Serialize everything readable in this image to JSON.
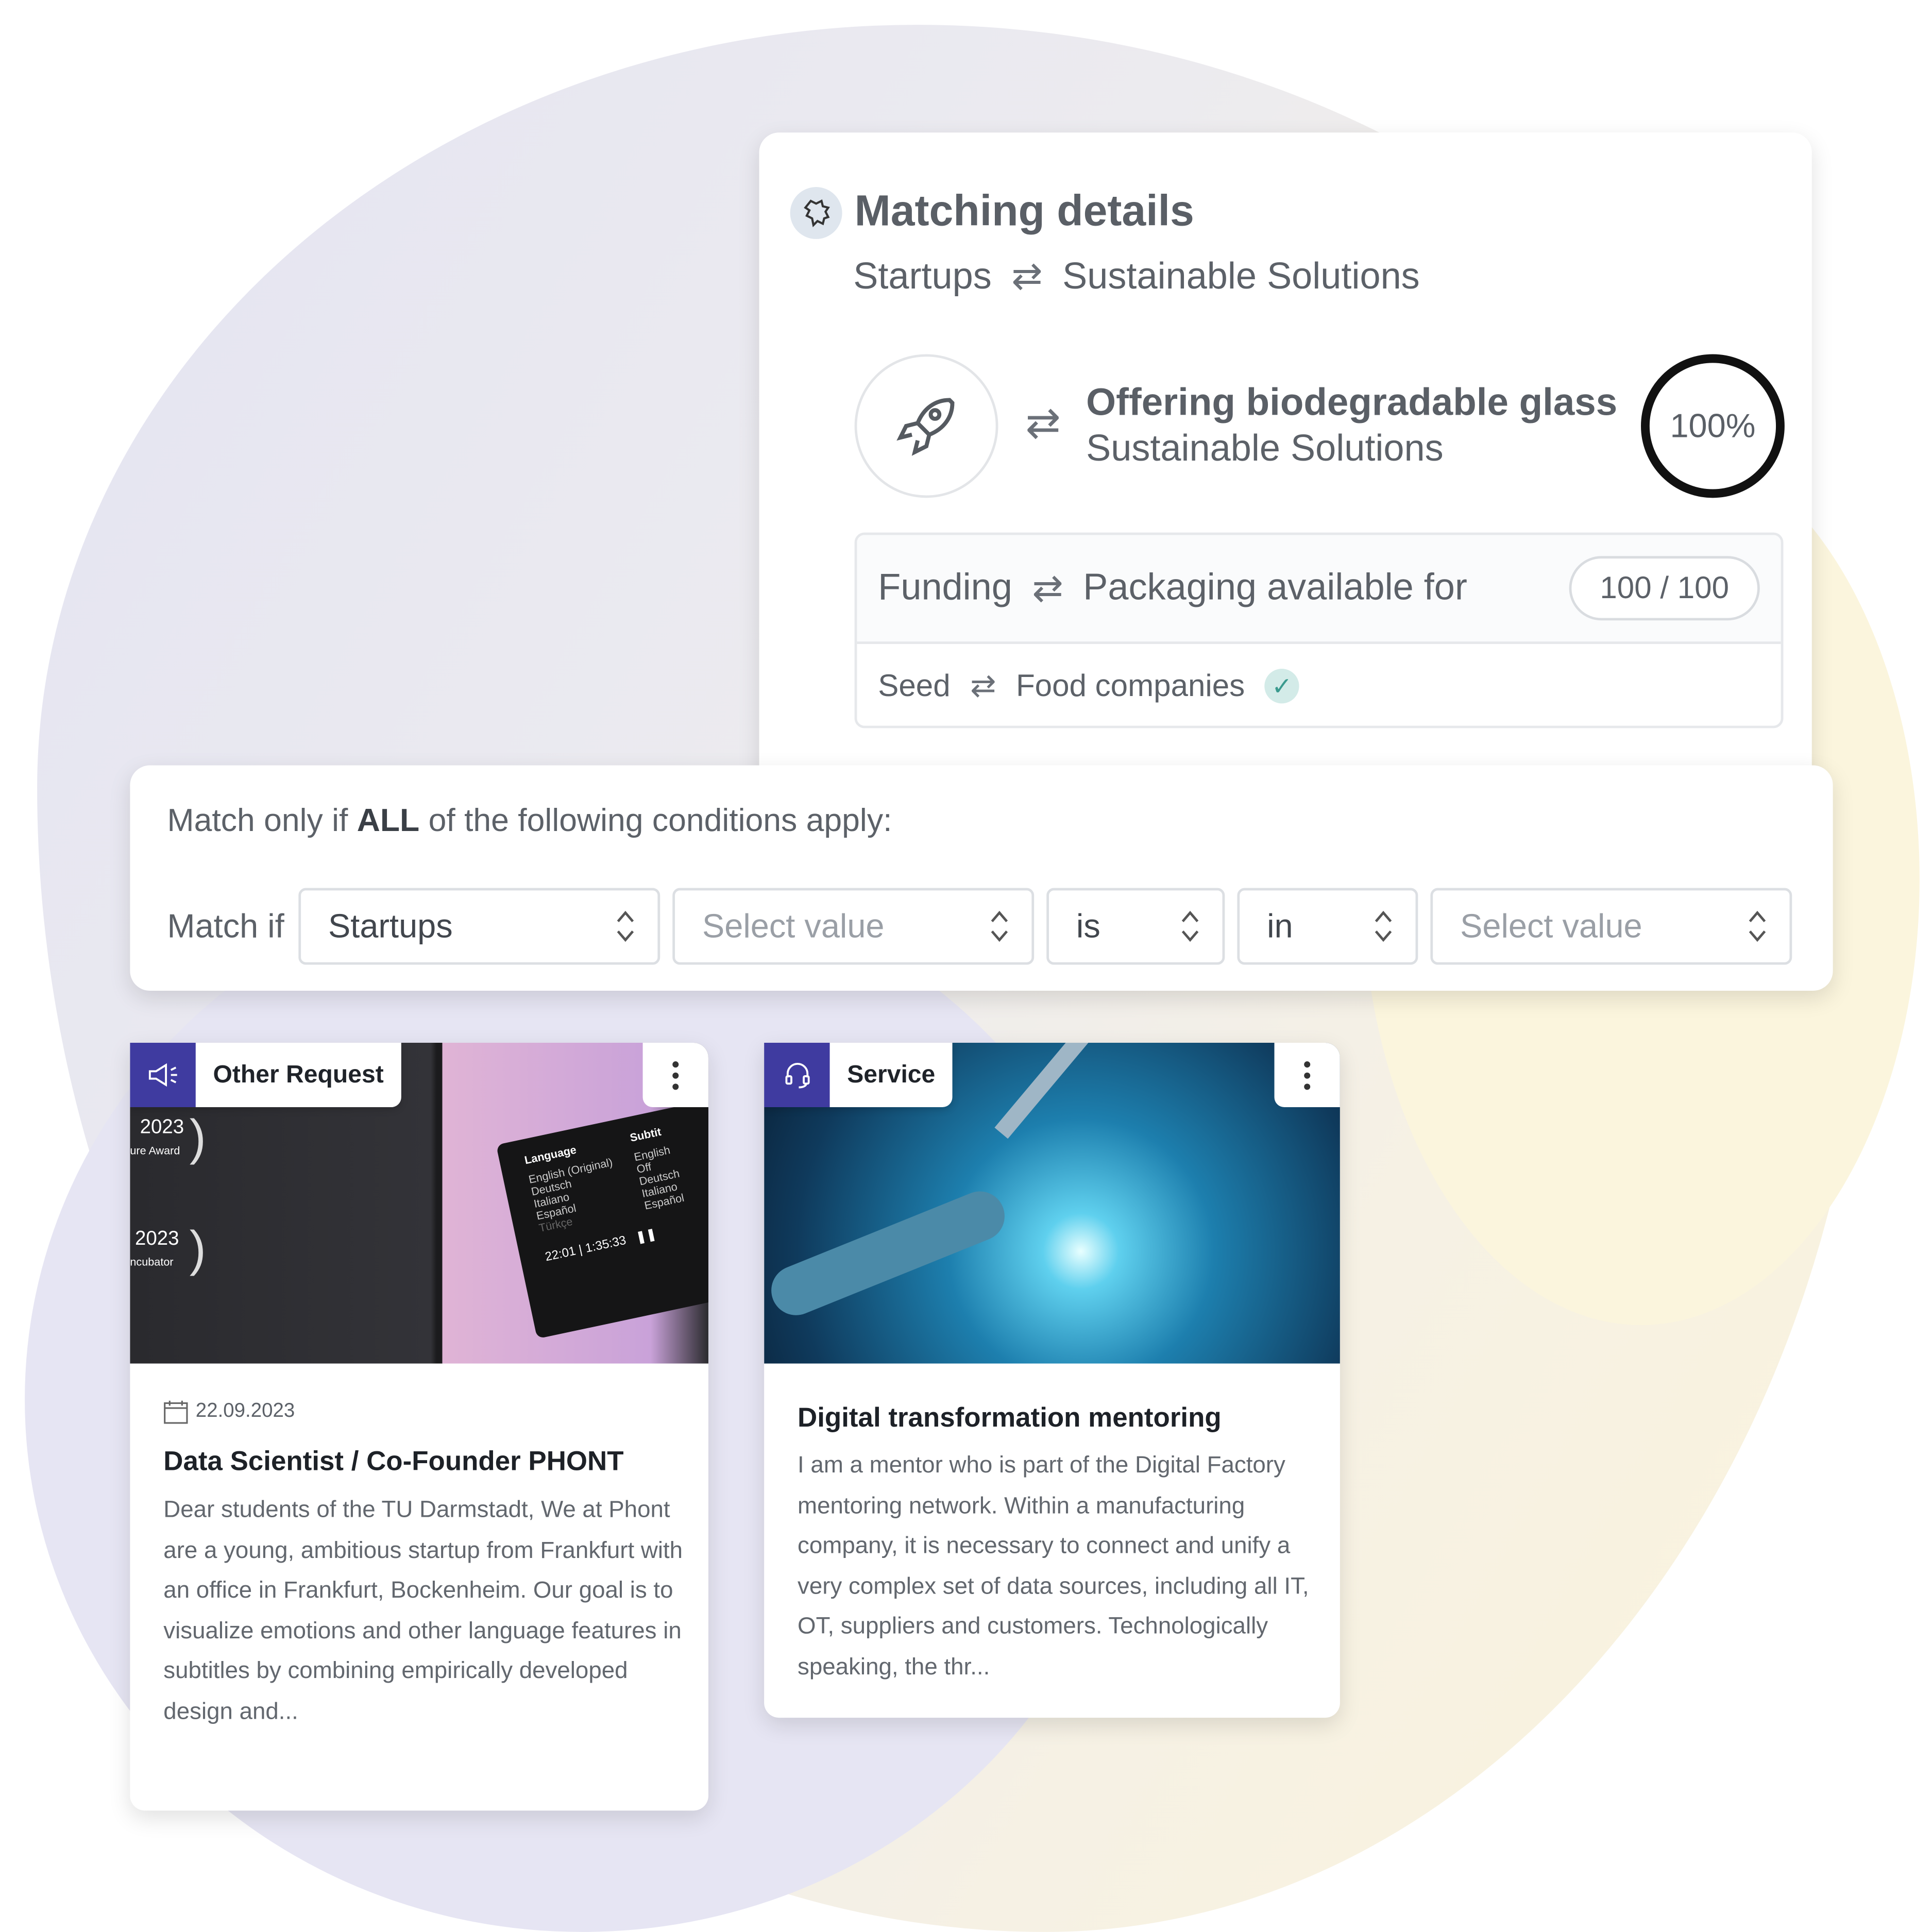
{
  "matching": {
    "title": "Matching details",
    "from": "Startups",
    "to": "Sustainable Solutions",
    "offer_title": "Offering biodegradable glass",
    "offer_subtitle": "Sustainable Solutions",
    "score": "100%",
    "score_value": 100,
    "criteria": {
      "left": "Funding",
      "right": "Packaging available for",
      "points": "100 / 100",
      "sub_left": "Seed",
      "sub_right": "Food companies",
      "matched": true,
      "check_color": "#cfe8e6"
    }
  },
  "conditions": {
    "prefix": "Match only if ",
    "emphasis": "ALL",
    "suffix": " of the following conditions apply:",
    "match_if_label": "Match if",
    "selects": [
      {
        "value": "Startups",
        "placeholder": false
      },
      {
        "value": "Select value",
        "placeholder": true
      },
      {
        "value": "is",
        "placeholder": false
      },
      {
        "value": "in",
        "placeholder": false
      },
      {
        "value": "Select value",
        "placeholder": true
      }
    ]
  },
  "cards": [
    {
      "tag": "Other Request",
      "tag_icon": "megaphone-icon",
      "date": "22.09.2023",
      "title": "Data Scientist / Co-Founder PHONT",
      "body": "Dear students of the TU Darmstadt, We at Phont are a young, ambitious startup from Frankfurt with an office in Frankfurt, Bockenheim. Our goal is to visualize emotions and other language features in subtitles by combining empirically developed design and...",
      "image": {
        "award1_year": "2023",
        "award1_sub": "ure Award",
        "award2_year": "2023",
        "award2_sub": "ncubator",
        "menu_heading": "Language",
        "menu_items": [
          "English (Original)",
          "Deutsch",
          "Italiano",
          "Español",
          "Türkçe"
        ],
        "subtitle_heading": "Subtit",
        "subtitle_items": [
          "English",
          "Off",
          "Deutsch",
          "Italiano",
          "Español"
        ],
        "time": "22:01",
        "duration": "1:35:33"
      }
    },
    {
      "tag": "Service",
      "tag_icon": "headset-icon",
      "title": "Digital transformation mentoring",
      "body": "I am a mentor who is part of the Digital Factory mentoring network. Within a manufacturing company, it is necessary to connect and unify a very complex set of data sources, including all IT, OT, suppliers and customers. Technologically speaking, the thr..."
    }
  ],
  "colors": {
    "accent": "#3f3ba0",
    "text": "#5c6168",
    "ring": "#111111"
  }
}
